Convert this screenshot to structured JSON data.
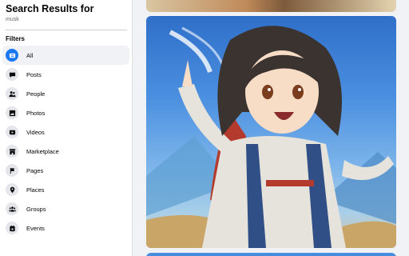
{
  "sidebar": {
    "title": "Search Results for",
    "query": "musk",
    "filters_heading": "Filters",
    "items": [
      {
        "label": "All",
        "icon": "all-icon"
      },
      {
        "label": "Posts",
        "icon": "posts-icon"
      },
      {
        "label": "People",
        "icon": "people-icon"
      },
      {
        "label": "Photos",
        "icon": "photos-icon"
      },
      {
        "label": "Videos",
        "icon": "videos-icon"
      },
      {
        "label": "Marketplace",
        "icon": "marketplace-icon"
      },
      {
        "label": "Pages",
        "icon": "pages-icon"
      },
      {
        "label": "Places",
        "icon": "places-icon"
      },
      {
        "label": "Groups",
        "icon": "groups-icon"
      },
      {
        "label": "Events",
        "icon": "events-icon"
      }
    ],
    "active_index": 0
  },
  "colors": {
    "accent": "#1877f2",
    "page_background": "#f0f2f5",
    "sidebar_background": "#ffffff"
  }
}
